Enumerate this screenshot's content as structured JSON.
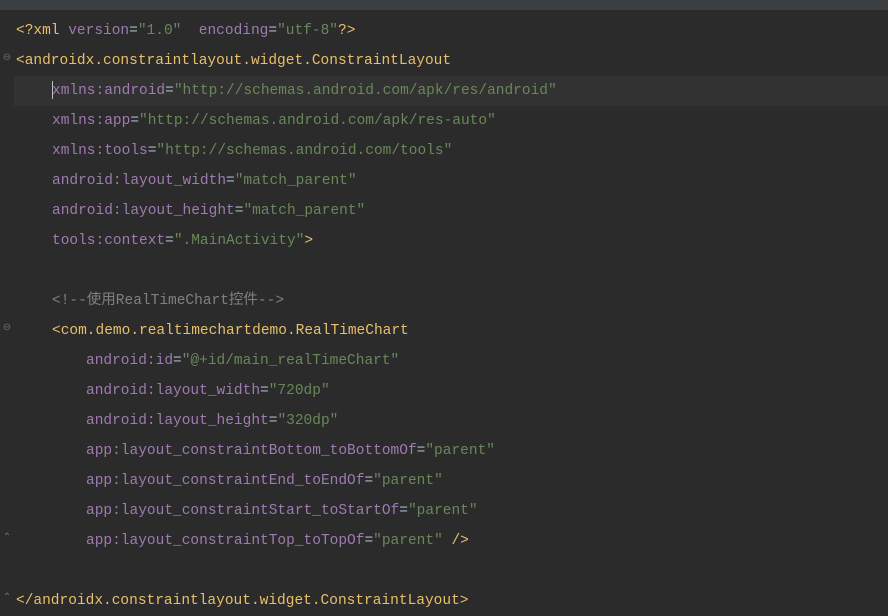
{
  "xml_decl": {
    "open": "<?",
    "name": "xml",
    "v_attr": "version",
    "v_val": "\"1.0\"",
    "e_attr": "encoding",
    "e_val": "\"utf-8\"",
    "close": "?>"
  },
  "root_open": {
    "lt": "<",
    "tag": "androidx.constraintlayout.widget.ConstraintLayout"
  },
  "ns_android": {
    "attr": "xmlns:android",
    "eq": "=",
    "val": "\"http://schemas.android.com/apk/res/android\""
  },
  "ns_app": {
    "attr": "xmlns:app",
    "eq": "=",
    "val": "\"http://schemas.android.com/apk/res-auto\""
  },
  "ns_tools": {
    "attr": "xmlns:tools",
    "eq": "=",
    "val": "\"http://schemas.android.com/tools\""
  },
  "root_w": {
    "attr": "android:layout_width",
    "eq": "=",
    "val": "\"match_parent\""
  },
  "root_h": {
    "attr": "android:layout_height",
    "eq": "=",
    "val": "\"match_parent\""
  },
  "root_ctx": {
    "attr": "tools:context",
    "eq": "=",
    "val": "\".MainActivity\"",
    "gt": ">"
  },
  "comment": "<!--使用RealTimeChart控件-->",
  "child_open": {
    "lt": "<",
    "tag": "com.demo.realtimechartdemo.RealTimeChart"
  },
  "child_id": {
    "attr": "android:id",
    "eq": "=",
    "val": "\"@+id/main_realTimeChart\""
  },
  "child_w": {
    "attr": "android:layout_width",
    "eq": "=",
    "val": "\"720dp\""
  },
  "child_h": {
    "attr": "android:layout_height",
    "eq": "=",
    "val": "\"320dp\""
  },
  "c_bottom": {
    "attr": "app:layout_constraintBottom_toBottomOf",
    "eq": "=",
    "val": "\"parent\""
  },
  "c_end": {
    "attr": "app:layout_constraintEnd_toEndOf",
    "eq": "=",
    "val": "\"parent\""
  },
  "c_start": {
    "attr": "app:layout_constraintStart_toStartOf",
    "eq": "=",
    "val": "\"parent\""
  },
  "c_top": {
    "attr": "app:layout_constraintTop_toTopOf",
    "eq": "=",
    "val": "\"parent\"",
    "close": " />"
  },
  "root_close": {
    "lt": "</",
    "tag": "androidx.constraintlayout.widget.ConstraintLayout",
    "gt": ">"
  },
  "fold": {
    "minus": "⊖",
    "up": "⌃"
  }
}
